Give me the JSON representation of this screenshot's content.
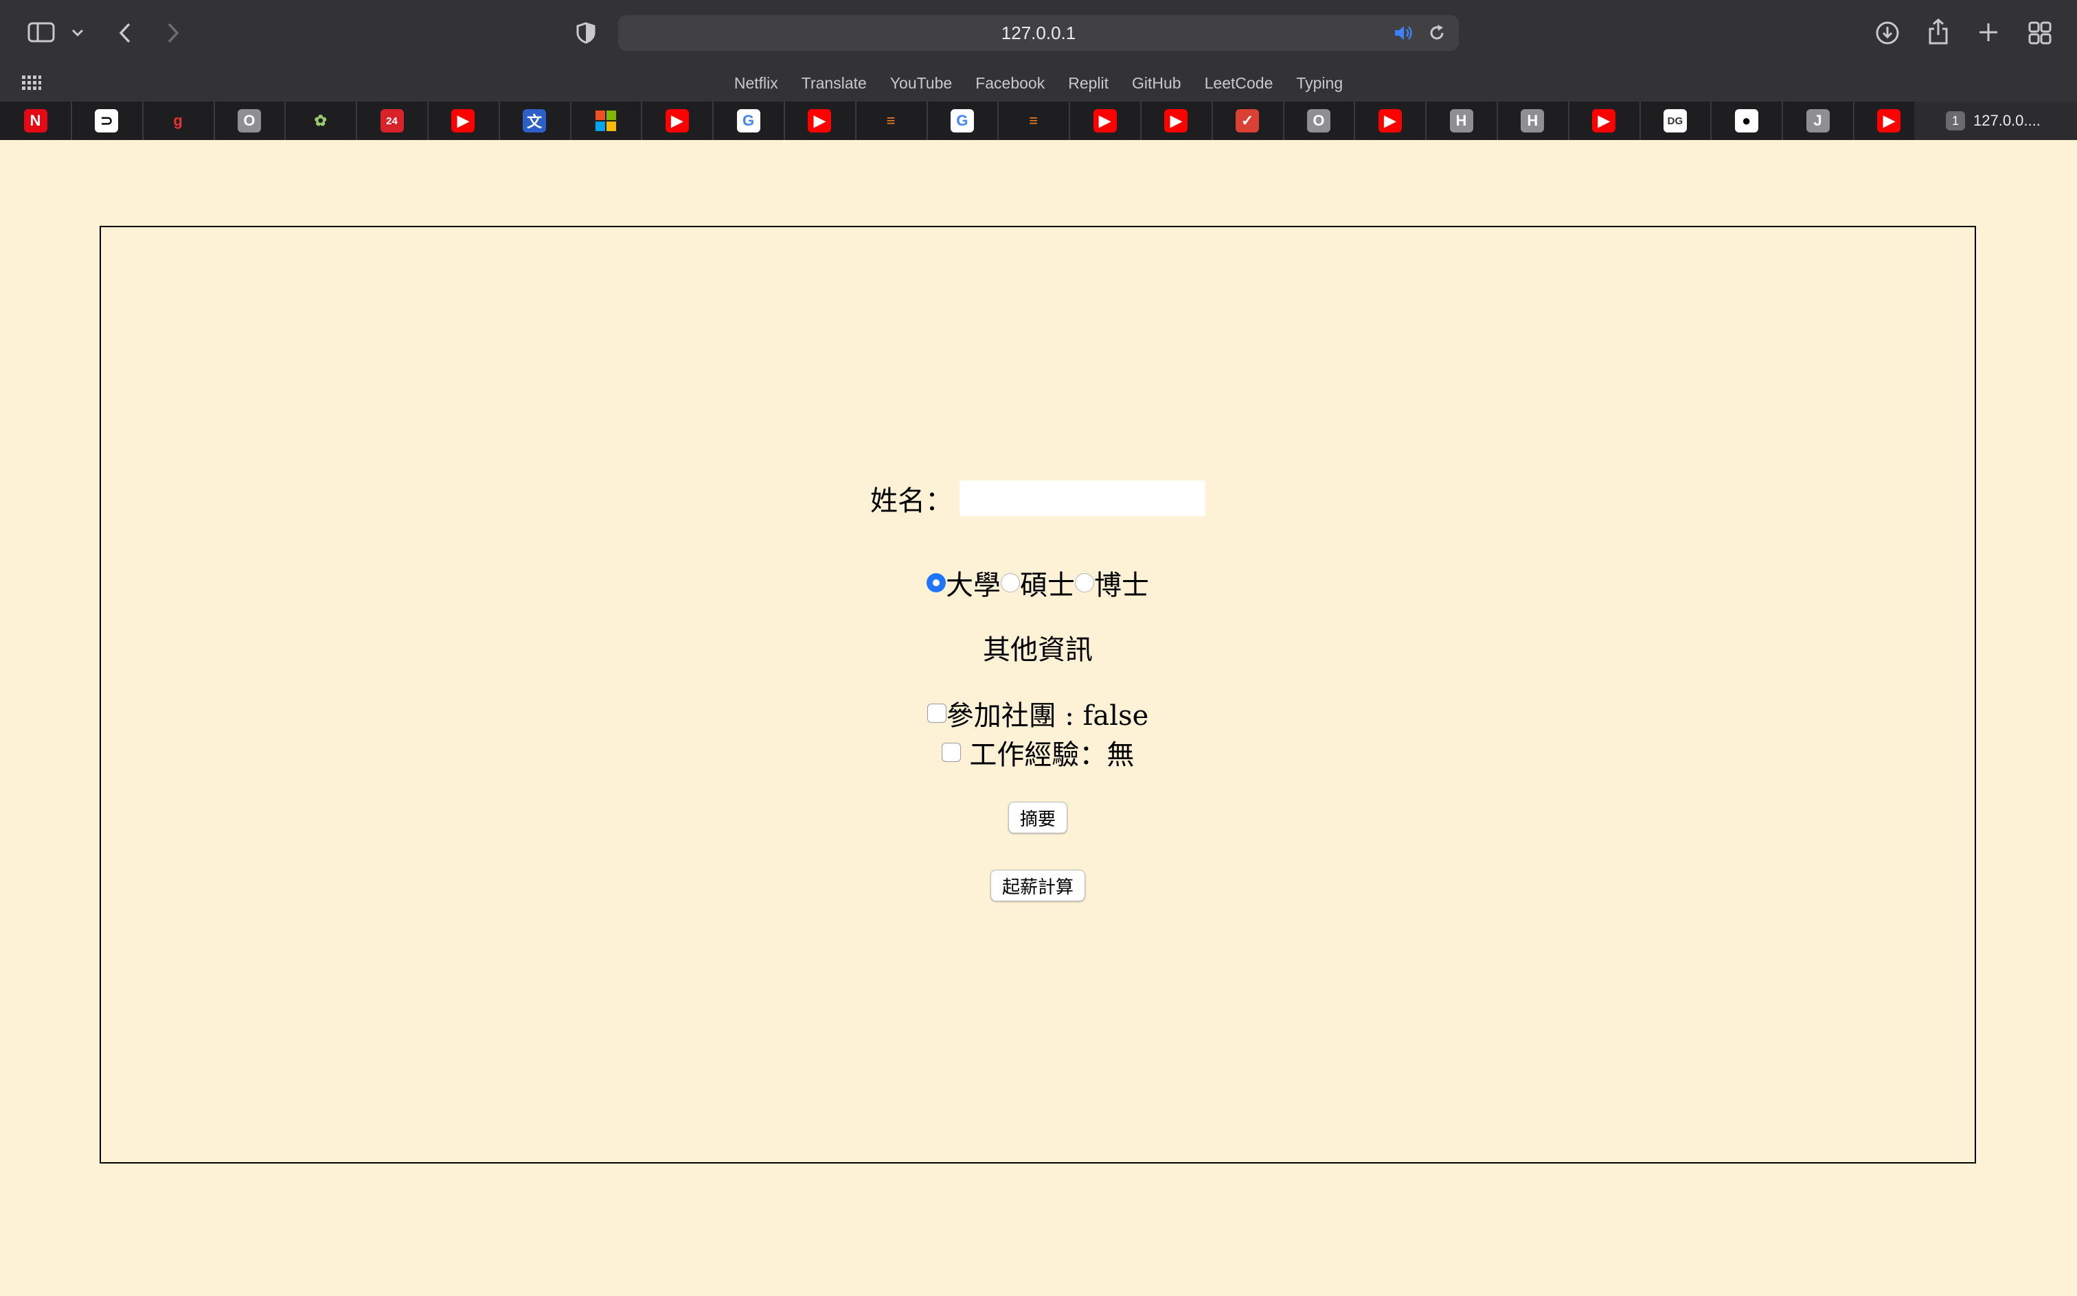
{
  "browser": {
    "url": "127.0.0.1",
    "favorites": [
      "Netflix",
      "Translate",
      "YouTube",
      "Facebook",
      "Replit",
      "GitHub",
      "LeetCode",
      "Typing"
    ],
    "pinned_tabs": [
      {
        "icon": "netflix-icon",
        "glyph": "N",
        "bg": "#e50914",
        "fg": "#ffffff"
      },
      {
        "icon": "codecademy-icon",
        "glyph": "⊃",
        "bg": "#ffffff",
        "fg": "#000000"
      },
      {
        "icon": "grammarly-icon",
        "glyph": "g",
        "bg": "#1e1e20",
        "fg": "#e8313a"
      },
      {
        "icon": "letter-o-icon",
        "glyph": "O",
        "bg": "#8e8e93",
        "fg": "#ffffff"
      },
      {
        "icon": "dragon-icon",
        "glyph": "✿",
        "bg": "#1e1e20",
        "fg": "#9cc96b"
      },
      {
        "icon": "number-24-icon",
        "glyph": "24",
        "bg": "#d8232a",
        "fg": "#ffffff"
      },
      {
        "icon": "youtube-icon",
        "glyph": "▶",
        "bg": "#ff0000",
        "fg": "#ffffff"
      },
      {
        "icon": "translate-icon",
        "glyph": "文",
        "bg": "#2d5fc8",
        "fg": "#ffffff"
      },
      {
        "icon": "microsoft-icon",
        "glyph": "",
        "bg": "#1e1e20",
        "fg": "#ffffff"
      },
      {
        "icon": "youtube-icon",
        "glyph": "▶",
        "bg": "#ff0000",
        "fg": "#ffffff"
      },
      {
        "icon": "google-icon",
        "glyph": "G",
        "bg": "#ffffff",
        "fg": "#4285f4"
      },
      {
        "icon": "youtube-icon",
        "glyph": "▶",
        "bg": "#ff0000",
        "fg": "#ffffff"
      },
      {
        "icon": "stackoverflow-icon",
        "glyph": "≡",
        "bg": "#1e1e20",
        "fg": "#f48024"
      },
      {
        "icon": "google-icon",
        "glyph": "G",
        "bg": "#ffffff",
        "fg": "#4285f4"
      },
      {
        "icon": "stackoverflow-icon",
        "glyph": "≡",
        "bg": "#1e1e20",
        "fg": "#f48024"
      },
      {
        "icon": "youtube-icon",
        "glyph": "▶",
        "bg": "#ff0000",
        "fg": "#ffffff"
      },
      {
        "icon": "youtube-icon",
        "glyph": "▶",
        "bg": "#ff0000",
        "fg": "#ffffff"
      },
      {
        "icon": "todoist-icon",
        "glyph": "✓",
        "bg": "#db4035",
        "fg": "#ffffff"
      },
      {
        "icon": "letter-o-icon",
        "glyph": "O",
        "bg": "#8e8e93",
        "fg": "#ffffff"
      },
      {
        "icon": "youtube-icon",
        "glyph": "▶",
        "bg": "#ff0000",
        "fg": "#ffffff"
      },
      {
        "icon": "letter-h-icon",
        "glyph": "H",
        "bg": "#8e8e93",
        "fg": "#ffffff"
      },
      {
        "icon": "letter-h-icon",
        "glyph": "H",
        "bg": "#8e8e93",
        "fg": "#ffffff"
      },
      {
        "icon": "youtube-icon",
        "glyph": "▶",
        "bg": "#ff0000",
        "fg": "#ffffff"
      },
      {
        "icon": "deepl-icon",
        "glyph": "DG",
        "bg": "#ffffff",
        "fg": "#333333"
      },
      {
        "icon": "github-icon",
        "glyph": "●",
        "bg": "#ffffff",
        "fg": "#000000"
      },
      {
        "icon": "letter-j-icon",
        "glyph": "J",
        "bg": "#8e8e93",
        "fg": "#ffffff"
      },
      {
        "icon": "youtube-icon",
        "glyph": "▶",
        "bg": "#ff0000",
        "fg": "#ffffff"
      }
    ],
    "active_tab": {
      "number": "1",
      "title": "127.0.0...."
    }
  },
  "form": {
    "name_label": "姓名：",
    "name_value": "",
    "degrees": [
      {
        "label": "大學",
        "checked": true
      },
      {
        "label": "碩士",
        "checked": false
      },
      {
        "label": "博士",
        "checked": false
      }
    ],
    "section_title": "其他資訊",
    "club_label": "參加社團 : false",
    "club_checked": false,
    "experience_label": " 工作經驗：無",
    "experience_checked": false,
    "summary_button": "摘要",
    "salary_button": "起薪計算"
  },
  "colors": {
    "page_bg": "#fdf1d6",
    "toolbar_bg": "#333335",
    "tabbar_bg": "#1e1e20",
    "radio_selected": "#1f75fe"
  }
}
